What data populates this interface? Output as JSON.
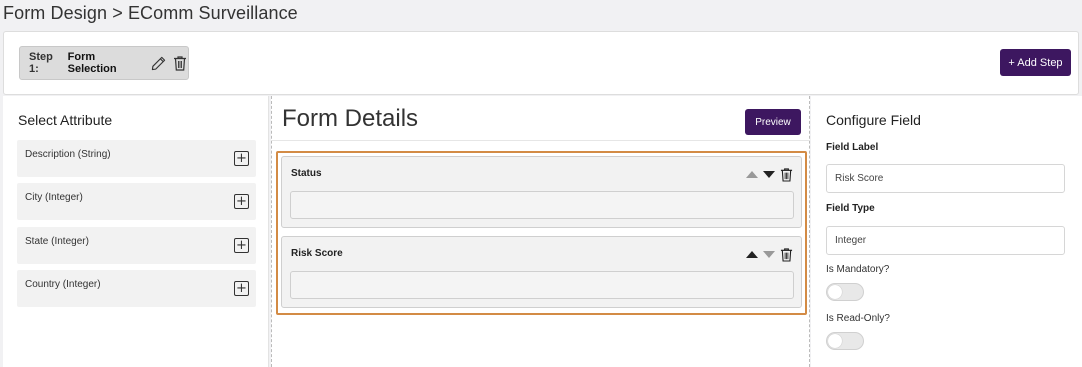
{
  "page": {
    "title": "Form Design > EComm Surveillance"
  },
  "steps": {
    "step_prefix": "Step 1:",
    "step_name": "Form Selection",
    "add_step_label": "+ Add Step"
  },
  "select_attribute": {
    "title": "Select Attribute",
    "items": [
      {
        "label": "Description (String)"
      },
      {
        "label": "City (Integer)"
      },
      {
        "label": "State (Integer)"
      },
      {
        "label": "Country (Integer)"
      }
    ]
  },
  "form_details": {
    "title": "Form Details",
    "preview_label": "Preview",
    "fields": [
      {
        "label": "Status",
        "value": ""
      },
      {
        "label": "Risk Score",
        "value": ""
      }
    ]
  },
  "configure_field": {
    "title": "Configure Field",
    "field_label_title": "Field Label",
    "field_label_value": "Risk Score",
    "field_type_title": "Field Type",
    "field_type_value": "Integer",
    "mandatory_label": "Is Mandatory?",
    "mandatory_on": false,
    "read_only_label": "Is Read-Only?",
    "read_only_on": false
  },
  "colors": {
    "primary": "#3d1760",
    "highlight_border": "#d38b45"
  },
  "icons": {
    "edit": "pencil-icon",
    "delete": "trash-icon",
    "add": "plus-square-icon",
    "move_up": "triangle-up-icon",
    "move_down": "triangle-down-icon"
  }
}
